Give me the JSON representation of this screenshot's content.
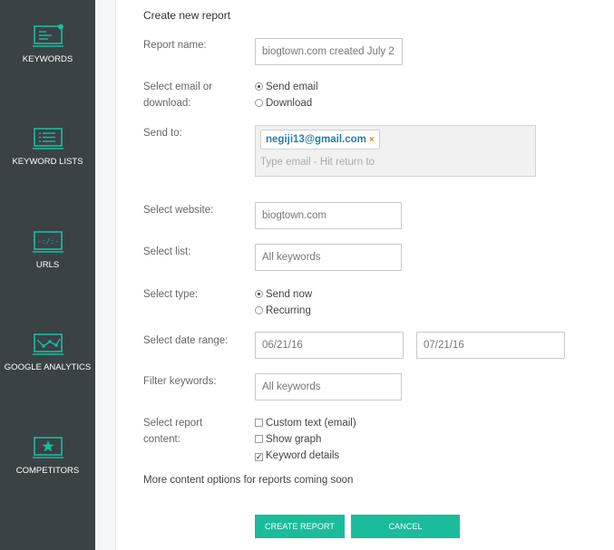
{
  "sidebar": {
    "items": [
      {
        "label": "KEYWORDS",
        "icon": "keywords-monitor-icon"
      },
      {
        "label": "KEYWORD LISTS",
        "icon": "keyword-lists-monitor-icon"
      },
      {
        "label": "URLS",
        "icon": "urls-monitor-icon"
      },
      {
        "label": "GOOGLE ANALYTICS",
        "icon": "analytics-monitor-icon"
      },
      {
        "label": "COMPETITORS",
        "icon": "competitors-monitor-icon"
      }
    ],
    "accent": "#1abc9c",
    "background": "#3a4246"
  },
  "form": {
    "heading": "Create new report",
    "report_name": {
      "label": "Report name:",
      "value": "biogtown.com created July 2"
    },
    "email_or_download": {
      "label_line1": "Select email or",
      "label_line2": "download:",
      "options": [
        "Send email",
        "Download"
      ],
      "selected": "Send email"
    },
    "send_to": {
      "label": "Send to:",
      "tag": "negiji13@gmail.com",
      "tag_remove": "×",
      "placeholder": "Type email - Hit return to"
    },
    "website": {
      "label": "Select website:",
      "value": "biogtown.com"
    },
    "list": {
      "label": "Select list:",
      "value": "All keywords"
    },
    "type": {
      "label": "Select type:",
      "options": [
        "Send now",
        "Recurring"
      ],
      "selected": "Send now"
    },
    "date_range": {
      "label": "Select date range:",
      "from": "06/21/16",
      "to": "07/21/16"
    },
    "filter": {
      "label": "Filter keywords:",
      "value": "All keywords"
    },
    "content": {
      "label_line1": "Select report",
      "label_line2": "content:",
      "options": [
        {
          "label": "Custom text (email)",
          "checked": false
        },
        {
          "label": "Show graph",
          "checked": false
        },
        {
          "label": "Keyword details",
          "checked": true
        }
      ]
    },
    "note": "More content options for reports coming soon",
    "create_button": "CREATE REPORT",
    "cancel_button": "CANCEL"
  }
}
